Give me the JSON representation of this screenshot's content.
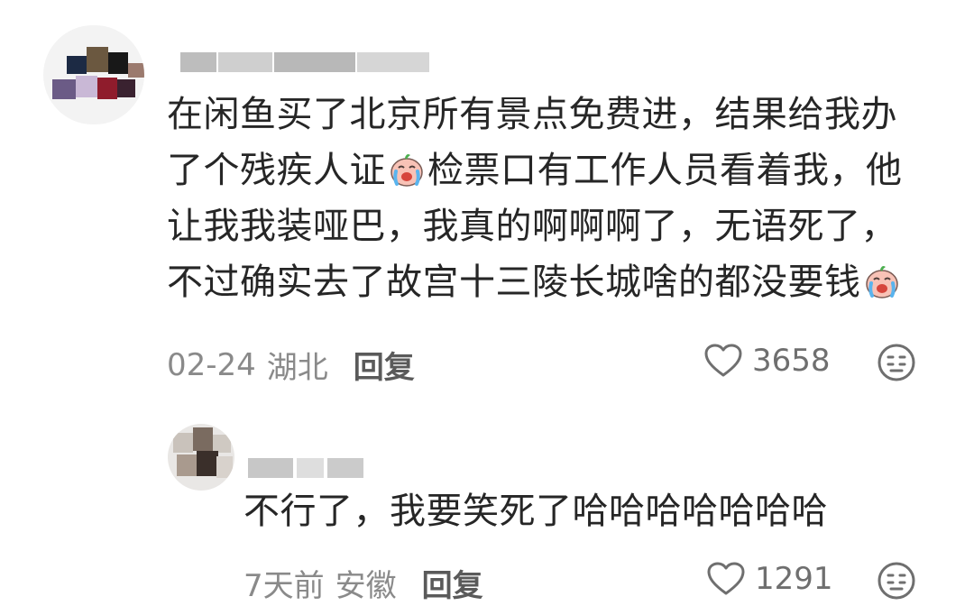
{
  "comments": [
    {
      "text_parts": [
        "在闲鱼买了北京所有景点免费进，结果给我办\n了个残疾人证",
        "检票口有工作人员看着我，他\n让我我装哑巴，我真的啊啊啊了，无语死了，\n不过确实去了故宫十三陵长城啥的都没要钱",
        ""
      ],
      "emoji": "crying-face",
      "date": "02-24",
      "location": "湖北",
      "reply_label": "回复",
      "likes": "3658"
    },
    {
      "text": "不行了，我要笑死了哈哈哈哈哈哈哈",
      "date": "7天前",
      "location": "安徽",
      "reply_label": "回复",
      "likes": "1291"
    }
  ],
  "colors": {
    "text": "#262626",
    "meta": "#8a8a8a",
    "reply": "#5a5a5a",
    "icon": "#6f6f6f"
  }
}
